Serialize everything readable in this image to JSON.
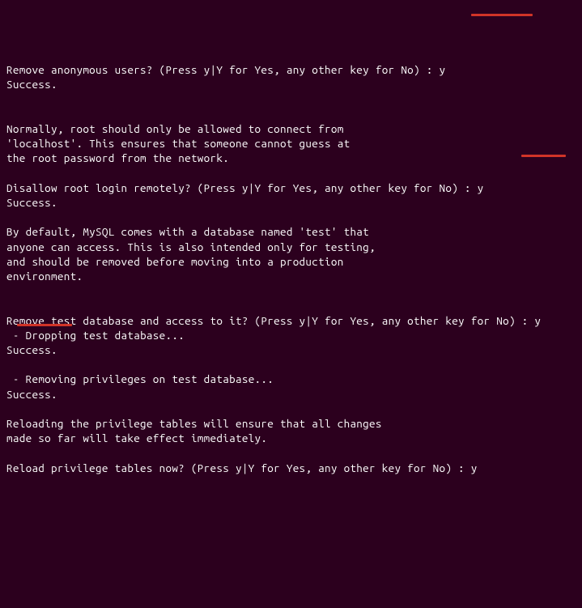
{
  "terminal": {
    "lines": [
      "Remove anonymous users? (Press y|Y for Yes, any other key for No) : y",
      "Success.",
      "",
      "",
      "Normally, root should only be allowed to connect from",
      "'localhost'. This ensures that someone cannot guess at",
      "the root password from the network.",
      "",
      "Disallow root login remotely? (Press y|Y for Yes, any other key for No) : y",
      "Success.",
      "",
      "By default, MySQL comes with a database named 'test' that",
      "anyone can access. This is also intended only for testing,",
      "and should be removed before moving into a production",
      "environment.",
      "",
      "",
      "Remove test database and access to it? (Press y|Y for Yes, any other key for No) : y",
      " - Dropping test database...",
      "Success.",
      "",
      " - Removing privileges on test database...",
      "Success.",
      "",
      "Reloading the privilege tables will ensure that all changes",
      "made so far will take effect immediately.",
      "",
      "Reload privilege tables now? (Press y|Y for Yes, any other key for No) : y"
    ]
  }
}
